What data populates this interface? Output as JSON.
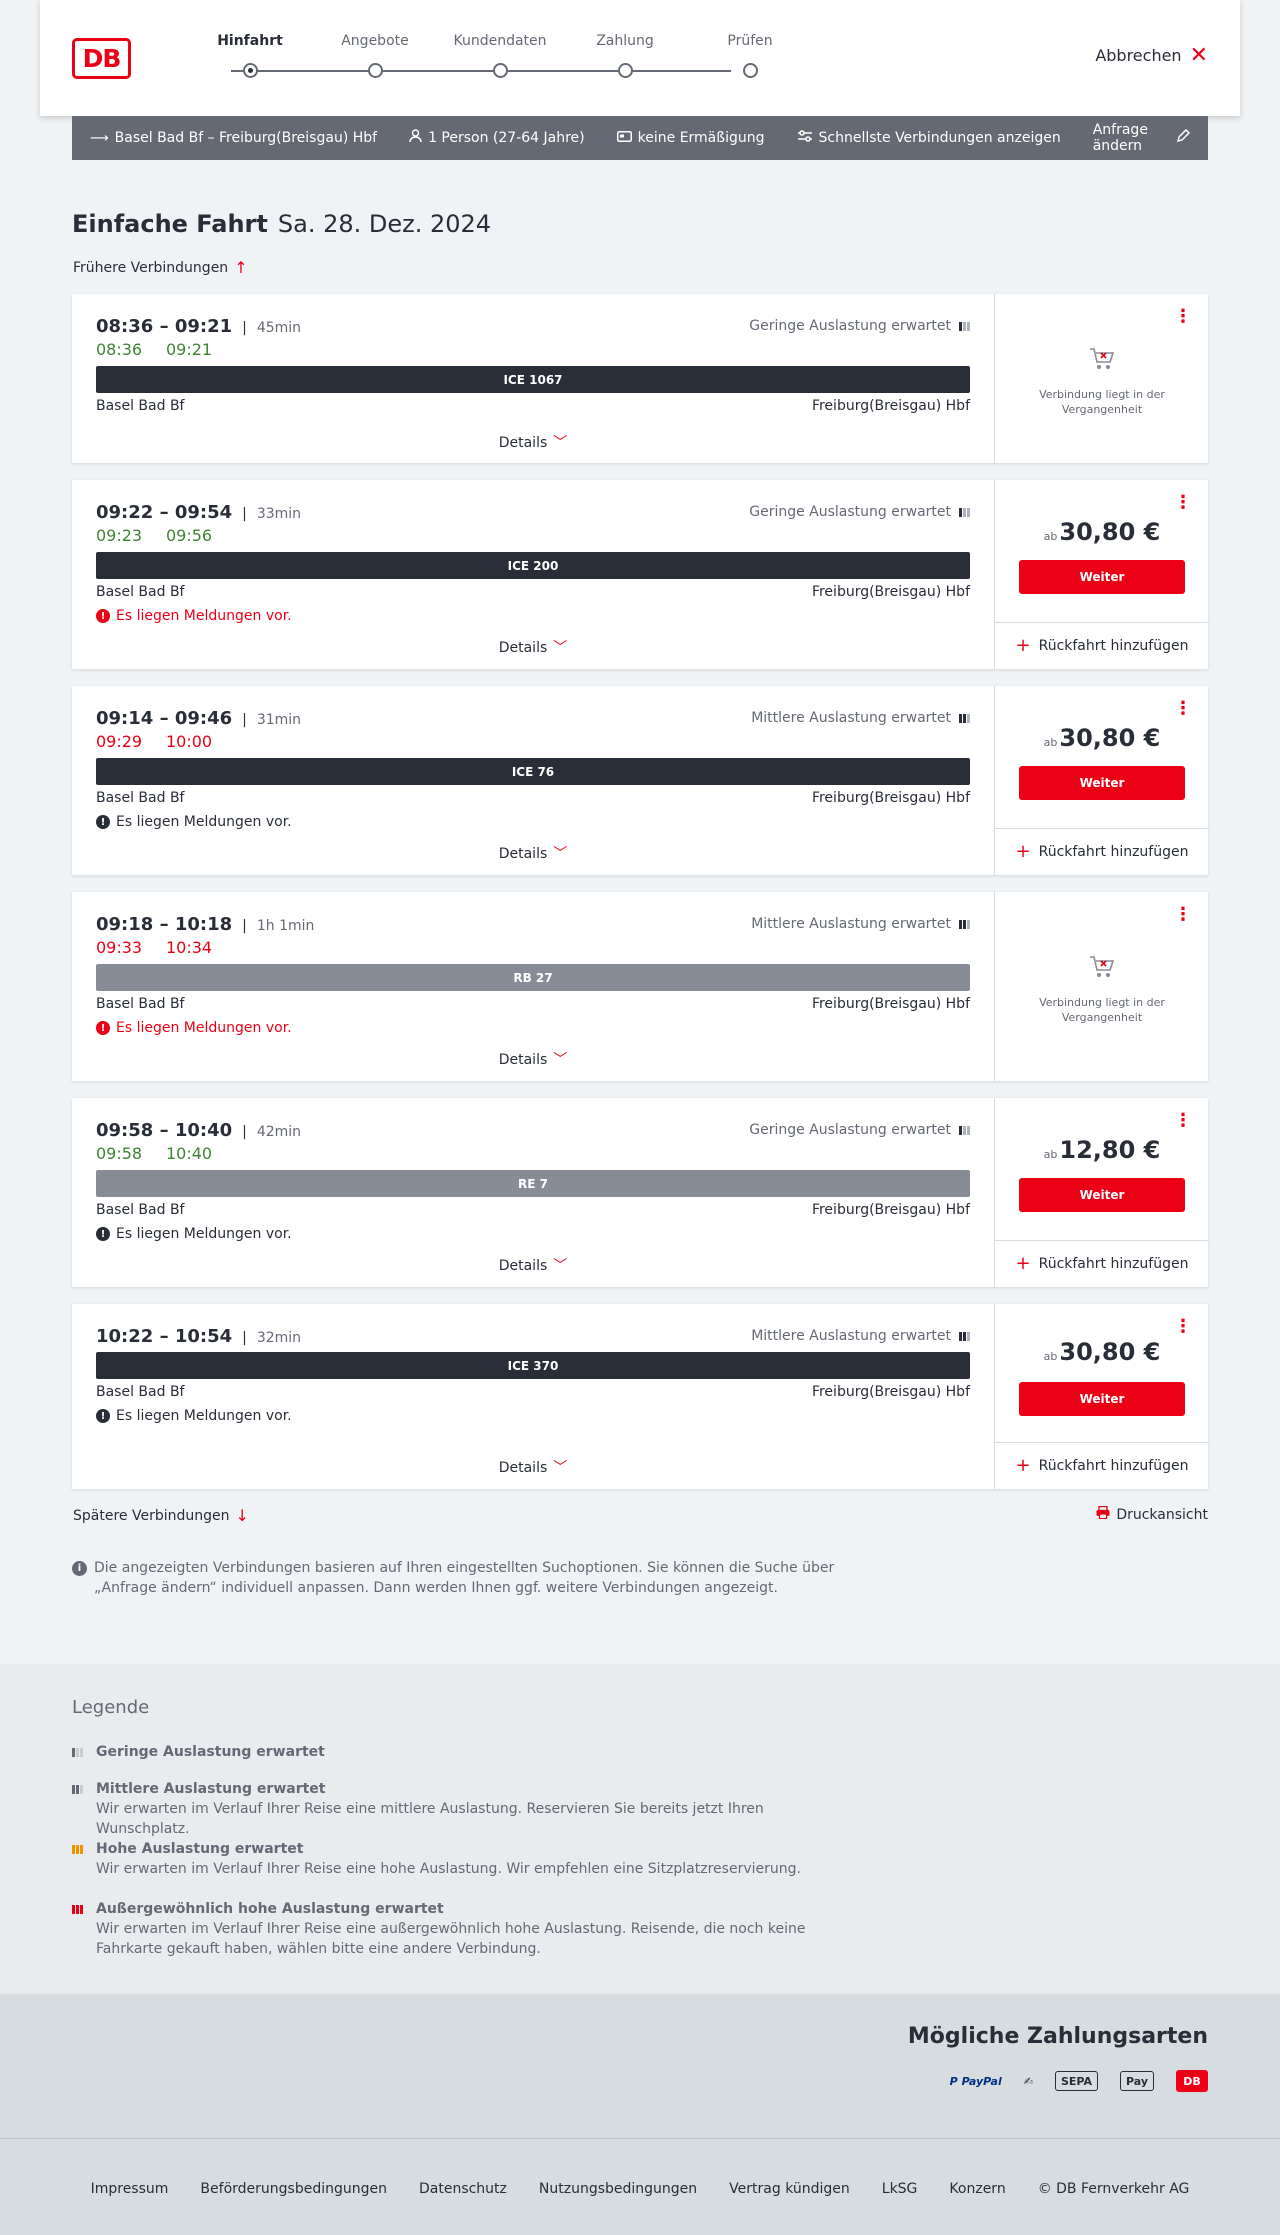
{
  "header": {
    "logo_text": "DB",
    "steps": [
      {
        "label": "Hinfahrt",
        "active": true
      },
      {
        "label": "Angebote",
        "active": false
      },
      {
        "label": "Kundendaten",
        "active": false
      },
      {
        "label": "Zahlung",
        "active": false
      },
      {
        "label": "Prüfen",
        "active": false
      }
    ],
    "cancel_label": "Abbrechen"
  },
  "search": {
    "route": "Basel Bad Bf – Freiburg(Breisgau) Hbf",
    "passengers": "1 Person (27-64 Jahre)",
    "discount": "keine Ermäßigung",
    "fastest": "Schnellste Verbindungen anzeigen",
    "edit_label": "Anfrage ändern"
  },
  "title": {
    "trip_type": "Einfache Fahrt",
    "date": "Sa. 28. Dez. 2024"
  },
  "earlier_label": "Frühere Verbindungen",
  "later_label": "Spätere Verbindungen",
  "print_label": "Druckansicht",
  "connections": [
    {
      "times": "08:36 – 09:21",
      "duration": "45min",
      "rt_dep": "08:36",
      "rt_arr": "09:21",
      "rt_status": "green",
      "occupancy": "Geringe Auslastung erwartet",
      "occupancy_level": 1,
      "train": "ICE 1067",
      "train_type": "ice",
      "from": "Basel Bad Bf",
      "to": "Freiburg(Breisgau) Hbf",
      "message": "",
      "message_style": "",
      "details_label": "Details",
      "past": true,
      "past_text": "Verbindung liegt in der Vergangenheit",
      "price": "",
      "price_prefix": "",
      "button_label": "",
      "return_label": ""
    },
    {
      "times": "09:22 – 09:54",
      "duration": "33min",
      "rt_dep": "09:23",
      "rt_arr": "09:56",
      "rt_status": "green",
      "occupancy": "Geringe Auslastung erwartet",
      "occupancy_level": 1,
      "train": "ICE 200",
      "train_type": "ice",
      "from": "Basel Bad Bf",
      "to": "Freiburg(Breisgau) Hbf",
      "message": "Es liegen Meldungen vor.",
      "message_style": "red",
      "details_label": "Details",
      "past": false,
      "past_text": "",
      "price": "30,80 €",
      "price_prefix": "ab",
      "button_label": "Weiter",
      "return_label": "Rückfahrt hinzufügen"
    },
    {
      "times": "09:14 – 09:46",
      "duration": "31min",
      "rt_dep": "09:29",
      "rt_arr": "10:00",
      "rt_status": "red",
      "occupancy": "Mittlere Auslastung erwartet",
      "occupancy_level": 2,
      "train": "ICE 76",
      "train_type": "ice",
      "from": "Basel Bad Bf",
      "to": "Freiburg(Breisgau) Hbf",
      "message": "Es liegen Meldungen vor.",
      "message_style": "black",
      "details_label": "Details",
      "past": false,
      "past_text": "",
      "price": "30,80 €",
      "price_prefix": "ab",
      "button_label": "Weiter",
      "return_label": "Rückfahrt hinzufügen"
    },
    {
      "times": "09:18 – 10:18",
      "duration": "1h 1min",
      "rt_dep": "09:33",
      "rt_arr": "10:34",
      "rt_status": "red",
      "occupancy": "Mittlere Auslastung erwartet",
      "occupancy_level": 2,
      "train": "RB 27",
      "train_type": "regio",
      "from": "Basel Bad Bf",
      "to": "Freiburg(Breisgau) Hbf",
      "message": "Es liegen Meldungen vor.",
      "message_style": "red",
      "details_label": "Details",
      "past": true,
      "past_text": "Verbindung liegt in der Vergangenheit",
      "price": "",
      "price_prefix": "",
      "button_label": "",
      "return_label": ""
    },
    {
      "times": "09:58 – 10:40",
      "duration": "42min",
      "rt_dep": "09:58",
      "rt_arr": "10:40",
      "rt_status": "green",
      "occupancy": "Geringe Auslastung erwartet",
      "occupancy_level": 1,
      "train": "RE 7",
      "train_type": "regio",
      "from": "Basel Bad Bf",
      "to": "Freiburg(Breisgau) Hbf",
      "message": "Es liegen Meldungen vor.",
      "message_style": "black",
      "details_label": "Details",
      "past": false,
      "past_text": "",
      "price": "12,80 €",
      "price_prefix": "ab",
      "button_label": "Weiter",
      "return_label": "Rückfahrt hinzufügen"
    },
    {
      "times": "10:22 – 10:54",
      "duration": "32min",
      "rt_dep": "",
      "rt_arr": "",
      "rt_status": "",
      "occupancy": "Mittlere Auslastung erwartet",
      "occupancy_level": 2,
      "train": "ICE 370",
      "train_type": "ice",
      "from": "Basel Bad Bf",
      "to": "Freiburg(Breisgau) Hbf",
      "message": "Es liegen Meldungen vor.",
      "message_style": "black",
      "details_label": "Details",
      "past": false,
      "past_text": "",
      "price": "30,80 €",
      "price_prefix": "ab",
      "button_label": "Weiter",
      "return_label": "Rückfahrt hinzufügen"
    }
  ],
  "info_note": "Die angezeigten Verbindungen basieren auf Ihren eingestellten Suchoptionen. Sie können die Suche über „Anfrage ändern“ individuell anpassen. Dann werden Ihnen ggf. weitere Verbindungen angezeigt.",
  "legend": {
    "title": "Legende",
    "items": [
      {
        "heading": "Geringe Auslastung erwartet",
        "text": ""
      },
      {
        "heading": "Mittlere Auslastung erwartet",
        "text": "Wir erwarten im Verlauf Ihrer Reise eine mittlere Auslastung. Reservieren Sie bereits jetzt Ihren Wunschplatz."
      },
      {
        "heading": "Hohe Auslastung erwartet",
        "text": "Wir erwarten im Verlauf Ihrer Reise eine hohe Auslastung. Wir empfehlen eine Sitzplatzreservierung."
      },
      {
        "heading": "Außergewöhnlich hohe Auslastung erwartet",
        "text": "Wir erwarten im Verlauf Ihrer Reise eine außergewöhnlich hohe Auslastung. Reisende, die noch keine Fahrkarte gekauft haben, wählen bitte eine andere Verbindung."
      }
    ]
  },
  "payments": {
    "title": "Mögliche Zahlungsarten",
    "icons": [
      {
        "name": "paypal-icon",
        "label": "P PayPal"
      },
      {
        "name": "direct-debit-icon",
        "label": "✍"
      },
      {
        "name": "sepa-icon",
        "label": "SEPA"
      },
      {
        "name": "apple-pay-icon",
        "label": "Pay"
      },
      {
        "name": "db-payment-icon",
        "label": "DB"
      }
    ]
  },
  "footer": {
    "links": [
      "Impressum",
      "Beförderungsbedingungen",
      "Datenschutz",
      "Nutzungsbedingungen",
      "Vertrag kündigen",
      "LkSG",
      "Konzern",
      "© DB Fernverkehr AG"
    ]
  },
  "colors": {
    "brand_red": "#ec0016",
    "on_time_green": "#408335",
    "dark": "#282d37",
    "bar_grey": "#878c96"
  }
}
